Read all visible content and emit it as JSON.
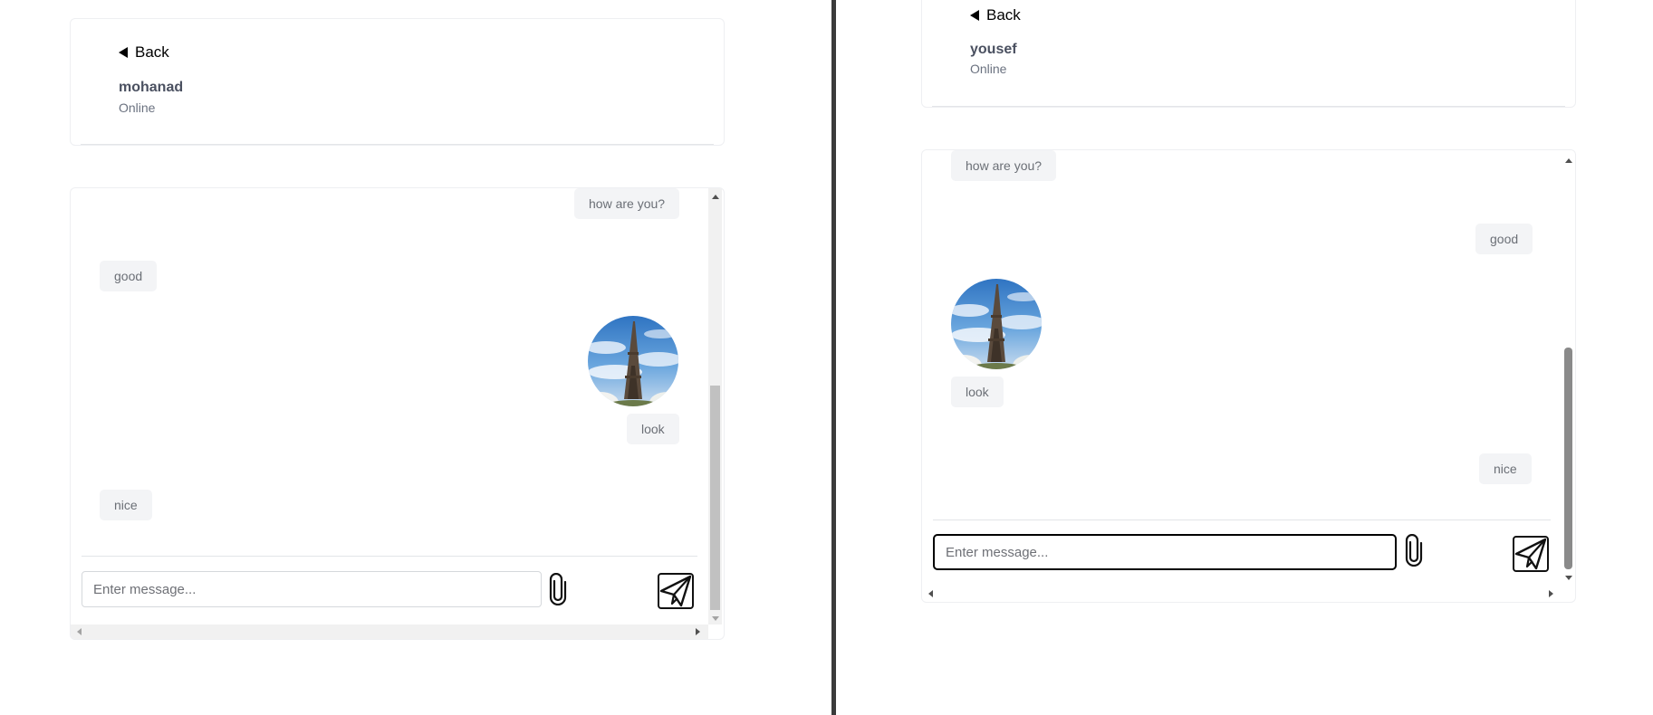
{
  "left_window": {
    "back_label": "Back",
    "contact_name": "mohanad",
    "contact_status": "Online",
    "messages": [
      {
        "side": "sent",
        "kind": "text",
        "text": "how are you?"
      },
      {
        "side": "received",
        "kind": "text",
        "text": "good"
      },
      {
        "side": "sent",
        "kind": "image",
        "description": "eiffel-tower-photo"
      },
      {
        "side": "sent",
        "kind": "text",
        "text": "look"
      },
      {
        "side": "received",
        "kind": "text",
        "text": "nice"
      }
    ],
    "input": {
      "value": "",
      "placeholder": "Enter message..."
    }
  },
  "right_window": {
    "back_label": "Back",
    "contact_name": "yousef",
    "contact_status": "Online",
    "messages": [
      {
        "side": "received",
        "kind": "text",
        "text": "how are you?"
      },
      {
        "side": "sent",
        "kind": "text",
        "text": "good"
      },
      {
        "side": "received",
        "kind": "image",
        "description": "eiffel-tower-photo"
      },
      {
        "side": "received",
        "kind": "text",
        "text": "look"
      },
      {
        "side": "sent",
        "kind": "text",
        "text": "nice"
      }
    ],
    "input": {
      "value": "",
      "placeholder": "Enter message...",
      "focused": true
    }
  },
  "icons": {
    "back": "back-triangle-icon",
    "attach": "paperclip-icon",
    "send": "paper-plane-icon"
  },
  "colors": {
    "bubble_bg": "#f3f4f6",
    "bubble_text": "#6b6f76",
    "name_text": "#4a5060",
    "status_text": "#6b7280",
    "divider": "#3b3b3b",
    "focus_border": "#000000"
  }
}
